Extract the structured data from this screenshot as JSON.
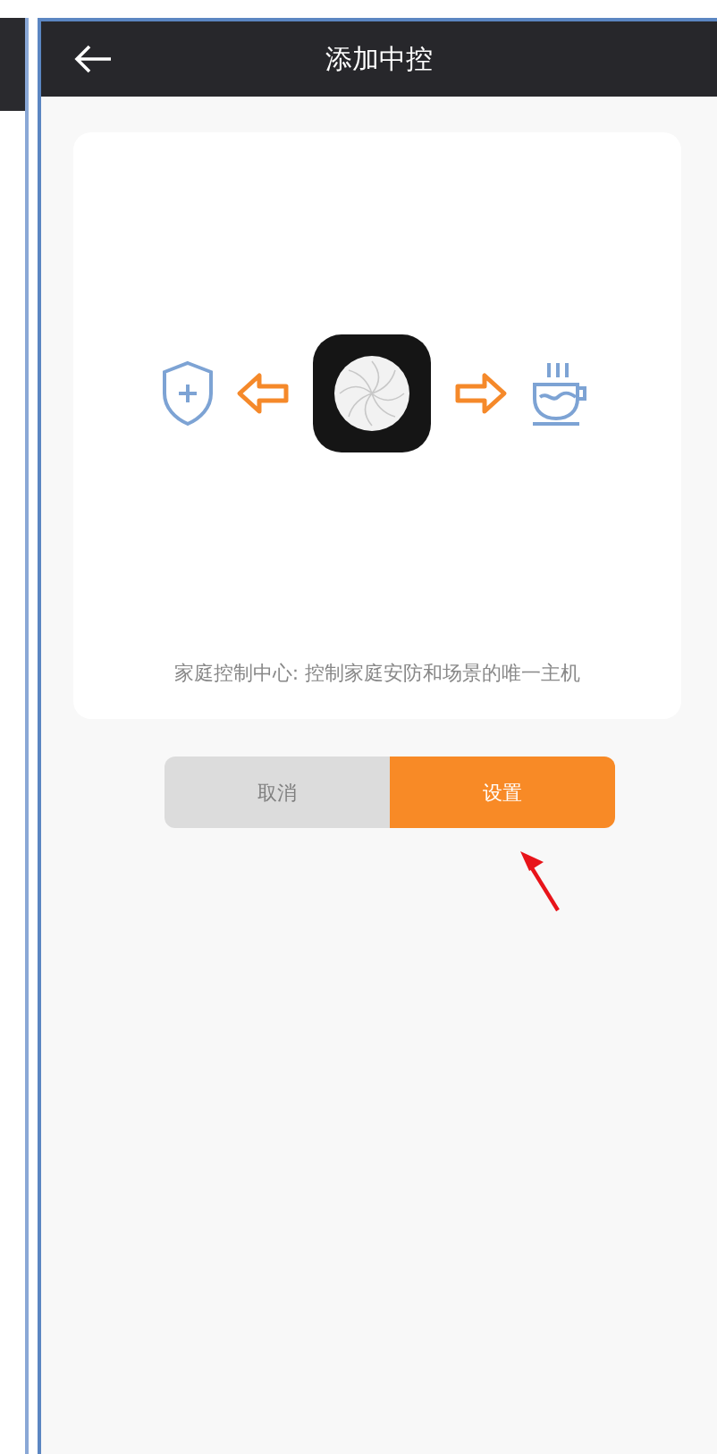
{
  "header": {
    "title": "添加中控"
  },
  "card": {
    "caption": "家庭控制中心: 控制家庭安防和场景的唯一主机"
  },
  "buttons": [
    {
      "label": "取消",
      "kind": "cancel"
    },
    {
      "label": "设置",
      "kind": "confirm"
    }
  ]
}
